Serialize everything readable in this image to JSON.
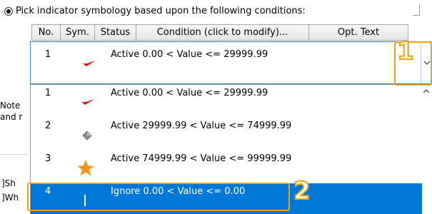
{
  "radio_label": "Pick indicator symbology based upon the following conditions:",
  "columns": [
    "No.",
    "Sym.",
    "Status",
    "Condition (click to modify)...",
    "Opt. Text"
  ],
  "current": {
    "no": "1",
    "status": "Active",
    "condition": "0.00 < Value <= 29999.99"
  },
  "rows": [
    {
      "no": "1",
      "icon": "red-check-icon",
      "status": "Active",
      "condition": "0.00 < Value <= 29999.99"
    },
    {
      "no": "2",
      "icon": "gray-diamond-icon",
      "status": "Active",
      "condition": "29999.99 < Value <= 74999.99"
    },
    {
      "no": "3",
      "icon": "orange-star-icon",
      "status": "Active",
      "condition": "74999.99 < Value <= 99999.99"
    },
    {
      "no": "4",
      "icon": "white-bar-icon",
      "status": "Ignore",
      "condition": "0.00 < Value <= 0.00"
    }
  ],
  "callouts": [
    "1",
    "2"
  ],
  "background_fragments": [
    "Note",
    "and r",
    "]Sh",
    "]Wh"
  ],
  "colors": {
    "accent": "#f0a30a",
    "selection": "#0078d7",
    "check": "#e0101e",
    "star": "#f7941d",
    "diamond": "#8c8c8c"
  }
}
